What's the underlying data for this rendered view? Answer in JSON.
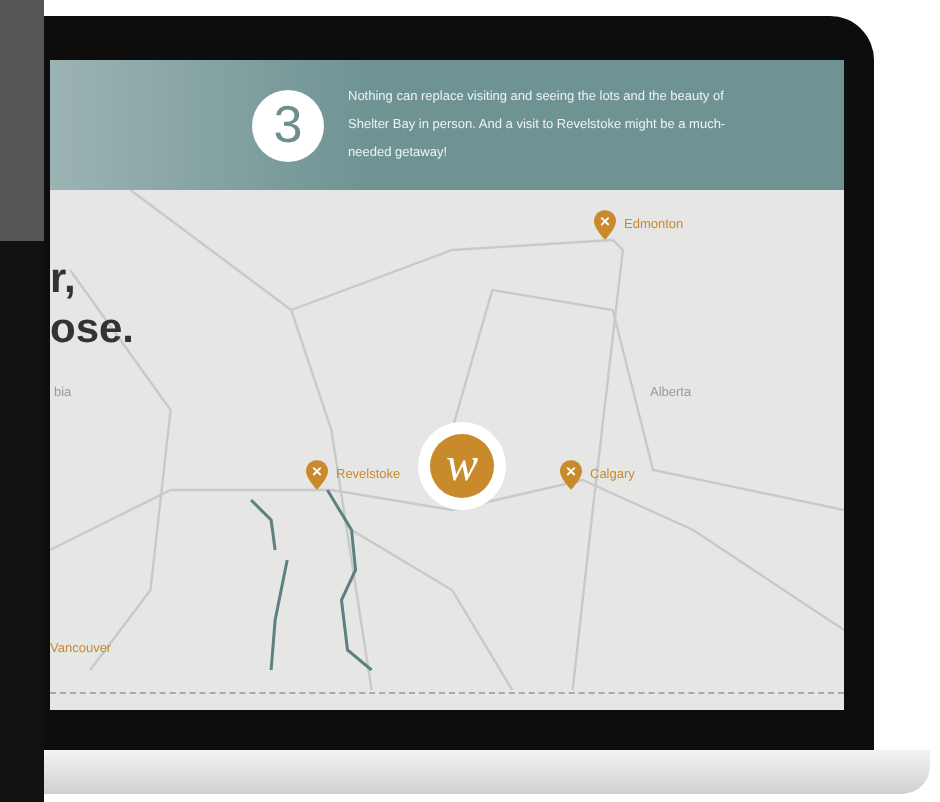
{
  "banner": {
    "step": "3",
    "text": "Nothing can replace visiting and seeing the lots and the beauty of Shelter Bay in person. And a visit to Revelstoke might be a much-needed getaway!"
  },
  "heading_fragments": [
    "r,",
    "ose."
  ],
  "map": {
    "places": [
      {
        "kind": "pin-city",
        "label": "Edmonton"
      },
      {
        "kind": "region",
        "label": "bia"
      },
      {
        "kind": "region",
        "label": "Alberta"
      },
      {
        "kind": "pin-city",
        "label": "Revelstoke"
      },
      {
        "kind": "pin-city",
        "label": "Calgary"
      },
      {
        "kind": "city",
        "label": "Vancouver"
      }
    ],
    "logo": "w"
  }
}
